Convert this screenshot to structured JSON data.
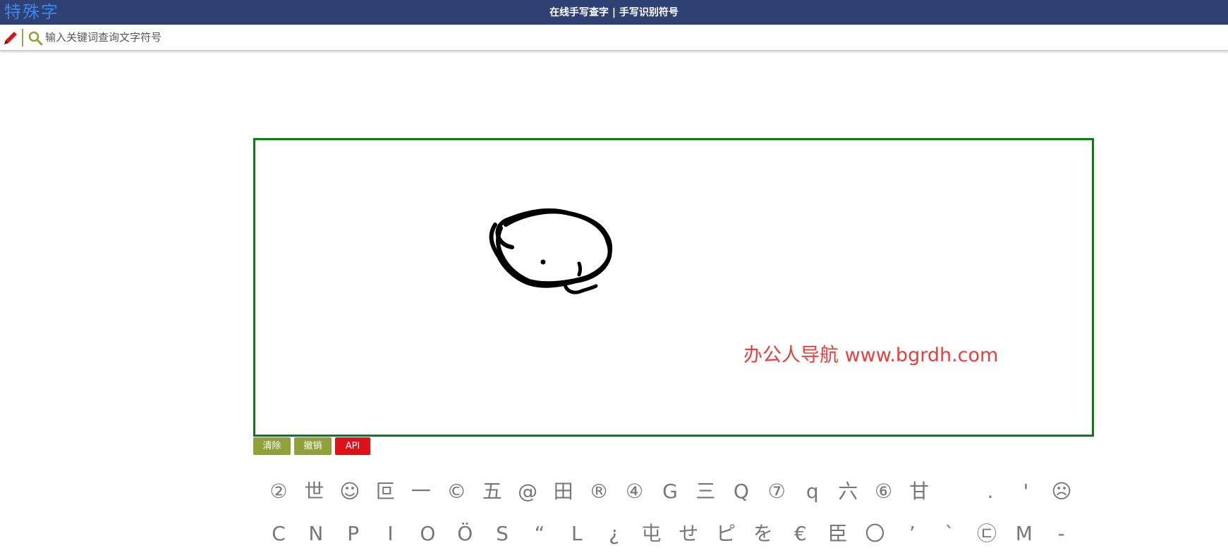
{
  "header": {
    "logo_text": "特殊字",
    "page_title": "在线手写查字 | 手写识别符号"
  },
  "search": {
    "placeholder": "输入关键词查询文字符号",
    "value": ""
  },
  "icons": {
    "pencil": "pencil-icon",
    "search": "search-icon"
  },
  "canvas": {
    "watermark": "办公人导航  www.bgrdh.com",
    "border_color": "#0a7d12"
  },
  "buttons": {
    "clear": "清除",
    "undo": "撤销",
    "api": "API"
  },
  "colors": {
    "header_bg": "#2e4172",
    "button_green": "#8fa138",
    "button_red": "#e0101b",
    "watermark_red": "#ea3e3e"
  },
  "candidates": {
    "row1": [
      "②",
      "世",
      "☺",
      "叵",
      "一",
      "©",
      "五",
      "@",
      "田",
      "®",
      "④",
      "G",
      "三",
      "Q",
      "⑦",
      "q",
      "六",
      "⑥",
      "甘",
      "",
      ".",
      "'",
      "☹"
    ],
    "row2": [
      "C",
      "N",
      "P",
      "I",
      "O",
      "Ö",
      "S",
      "“",
      "L",
      "¿",
      "屯",
      "せ",
      "ピ",
      "を",
      "€",
      "臣",
      "〇",
      "’",
      "`",
      "㉢",
      "M",
      "-"
    ]
  }
}
